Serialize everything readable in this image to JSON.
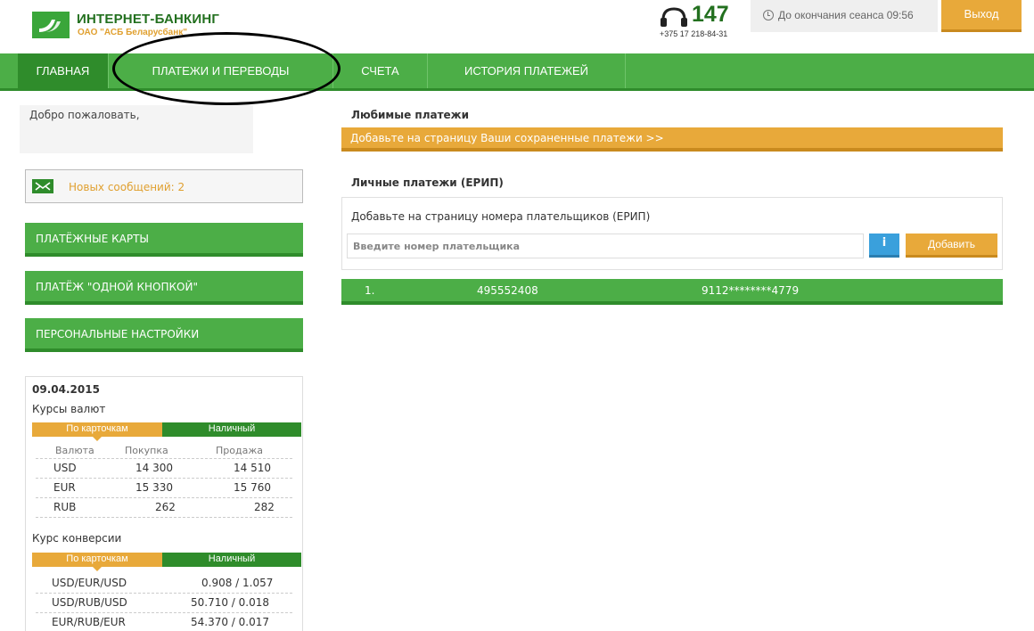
{
  "header": {
    "logo_title": "ИНТЕРНЕТ-БАНКИНГ",
    "logo_subtitle": "ОАО \"АСБ Беларусбанк\"",
    "phone_short": "147",
    "phone_full": "+375 17 218-84-31",
    "session_text": "До окончания сеанса 09:56",
    "logout_label": "Выход"
  },
  "nav": {
    "tabs": [
      {
        "label": "ГЛАВНАЯ"
      },
      {
        "label": "ПЛАТЕЖИ И ПЕРЕВОДЫ"
      },
      {
        "label": "СЧЕТА"
      },
      {
        "label": "ИСТОРИЯ ПЛАТЕЖЕЙ"
      }
    ]
  },
  "sidebar": {
    "welcome": "Добро пожаловать,",
    "messages": "Новых сообщений: 2",
    "buttons": [
      {
        "label": "ПЛАТЁЖНЫЕ КАРТЫ"
      },
      {
        "label": "ПЛАТЁЖ \"ОДНОЙ КНОПКОЙ\""
      },
      {
        "label": "ПЕРСОНАЛЬНЫЕ НАСТРОЙКИ"
      }
    ]
  },
  "rates": {
    "date": "09.04.2015",
    "title": "Курсы валют",
    "tab_cards": "По карточкам",
    "tab_cash": "Наличный",
    "headers": {
      "currency": "Валюта",
      "buy": "Покупка",
      "sell": "Продажа"
    },
    "rows": [
      {
        "currency": "USD",
        "buy": "14 300",
        "sell": "14 510"
      },
      {
        "currency": "EUR",
        "buy": "15 330",
        "sell": "15 760"
      },
      {
        "currency": "RUB",
        "buy": "262",
        "sell": "282"
      }
    ],
    "conversion_title": "Курс конверсии",
    "conversion_rows": [
      {
        "pair": "USD/EUR/USD",
        "value": "0.908 / 1.057"
      },
      {
        "pair": "USD/RUB/USD",
        "value": "50.710 / 0.018"
      },
      {
        "pair": "EUR/RUB/EUR",
        "value": "54.370 / 0.017"
      }
    ]
  },
  "main": {
    "favorites_title": "Любимые платежи",
    "favorites_bar": "Добавьте на страницу Ваши сохраненные платежи >>",
    "erip_title": "Личные платежи (ЕРИП)",
    "erip_hint": "Добавьте на страницу номера плательщиков (ЕРИП)",
    "erip_placeholder": "Введите номер плательщика",
    "info_label": "i",
    "add_label": "Добавить",
    "payer": {
      "index": "1.",
      "number": "495552408",
      "card": "9112********4779"
    }
  },
  "colors": {
    "brand_green": "#4cae47",
    "dark_green": "#2f8c2b",
    "accent_orange": "#e8a93a",
    "info_blue": "#3aa0dc"
  }
}
